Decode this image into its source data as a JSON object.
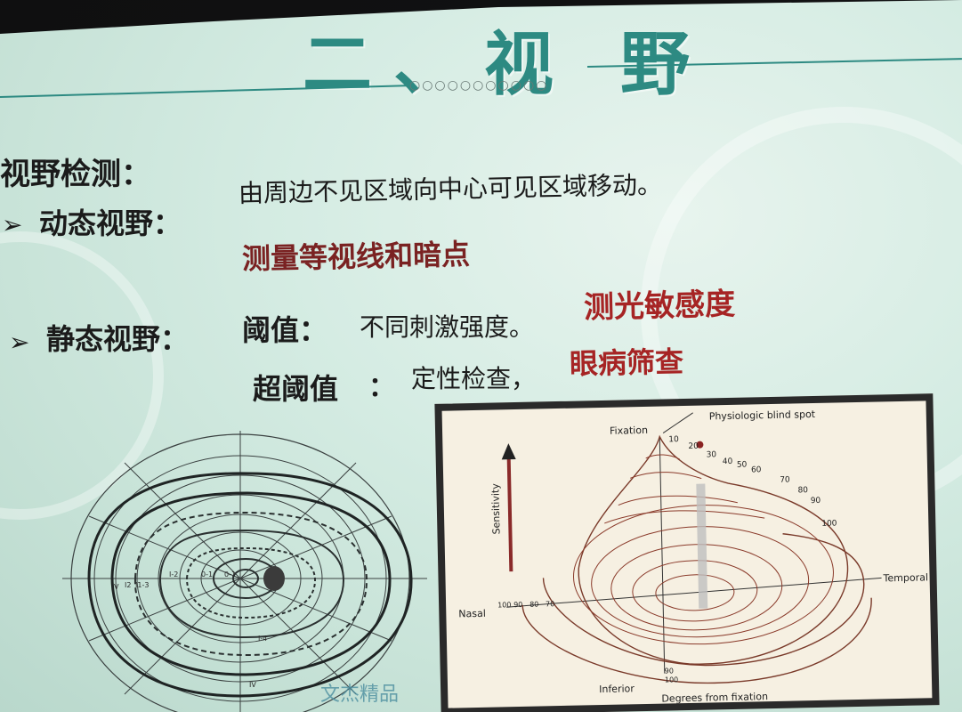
{
  "slide": {
    "title": "二、视 野",
    "dots": "○○○○○○○○○○○",
    "heading": "视野检测：",
    "kinetic_label": "动态视野：",
    "kinetic_desc": "由周边不见区域向中心可见区域移动。",
    "kinetic_measure": "测量等视线和暗点",
    "static_label": "静态视野：",
    "threshold_label": "阈值：",
    "threshold_desc": "不同刺激强度。",
    "threshold_measure": "测光敏感度",
    "supra_label": "超阈值",
    "supra_colon": "：",
    "supra_desc": "定性检查，",
    "supra_measure": "眼病筛查",
    "watermark": "文杰精品"
  },
  "island_figure": {
    "fixation": "Fixation",
    "blind_spot": "Physiologic blind spot",
    "sensitivity": "Sensitivity",
    "nasal": "Nasal",
    "temporal": "Temporal",
    "inferior": "Inferior",
    "degrees": "Degrees from fixation",
    "upper_ticks": [
      "10",
      "20",
      "30",
      "40",
      "50",
      "60",
      "70",
      "80",
      "90",
      "100"
    ],
    "nasal_ticks": [
      "100",
      "90",
      "80",
      "70"
    ],
    "inferior_ticks": [
      "90",
      "100"
    ]
  },
  "colors": {
    "title": "#2d8a82",
    "highlight_red": "#a62424",
    "island_line": "#8a3a2a"
  }
}
